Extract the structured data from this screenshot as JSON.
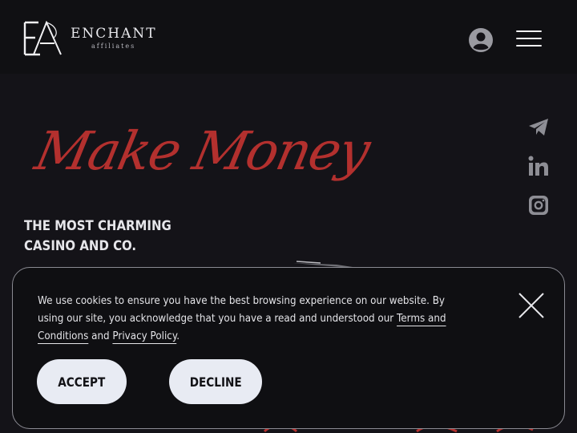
{
  "header": {
    "brand_name": "ENCHANT",
    "brand_sub": "affiliates"
  },
  "hero": {
    "title": "Make Money",
    "subtitle_line1": "THE MOST CHARMING",
    "subtitle_line2": "CASINO AND CO."
  },
  "icons": {
    "user": "user-circle-icon",
    "menu": "hamburger-menu-icon",
    "telegram": "telegram-icon",
    "linkedin": "linkedin-icon",
    "instagram": "instagram-icon",
    "close": "close-icon"
  },
  "cookie": {
    "text_part1": "We use cookies to ensure you have the best browsing experience on our website. By using our site, you acknowledge that you have a read and understood our ",
    "terms_link": "Terms and Conditions",
    "text_and": " and ",
    "privacy_link": "Privacy Policy",
    "text_end": ".",
    "accept_label": "ACCEPT",
    "decline_label": "DECLINE"
  },
  "colors": {
    "background": "#141318",
    "accent_red": "#b3302e",
    "button_bg": "#e8ebf3",
    "icon_gray": "#8e8e95"
  }
}
